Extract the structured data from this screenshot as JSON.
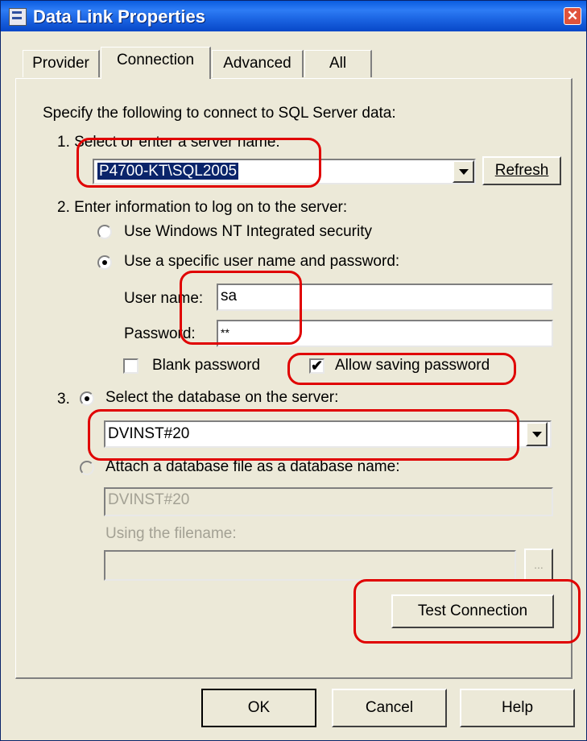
{
  "window": {
    "title": "Data Link Properties",
    "close_glyph": "✕"
  },
  "tabs": [
    {
      "label": "Provider",
      "active": false
    },
    {
      "label": "Connection",
      "active": true
    },
    {
      "label": "Advanced",
      "active": false
    },
    {
      "label": "All",
      "active": false
    }
  ],
  "connection": {
    "intro": "Specify the following to connect to SQL Server data:",
    "step1_label": "1. Select or enter a server name:",
    "server_value": "P4700-KT\\SQL2005",
    "refresh_label": "Refresh",
    "step2_label": "2. Enter information to log on to the server:",
    "radio_windows_nt": "Use Windows NT Integrated security",
    "radio_specific_user": "Use a specific user name and password:",
    "username_label": "User name:",
    "username_value": "sa",
    "password_label": "Password:",
    "password_value": "**",
    "blank_password_label": "Blank password",
    "allow_saving_label": "Allow saving password",
    "step3_number": "3.",
    "radio_select_db": "Select the database on the server:",
    "database_value": "DVINST#20",
    "radio_attach_db": "Attach a database file as a database name:",
    "attach_name_value": "DVINST#20",
    "filename_label": "Using the filename:",
    "filename_value": "",
    "browse_label": "...",
    "test_connection_label": "Test Connection"
  },
  "footer": {
    "ok_label": "OK",
    "cancel_label": "Cancel",
    "help_label": "Help"
  },
  "state": {
    "auth_mode": "specific_user",
    "blank_password_checked": false,
    "allow_saving_checked": true,
    "db_mode": "select_database"
  },
  "colors": {
    "title_bar": "#1b64e2",
    "annotation": "#e00000",
    "dialog_bg": "#ece9d8",
    "selection": "#0a246a"
  }
}
